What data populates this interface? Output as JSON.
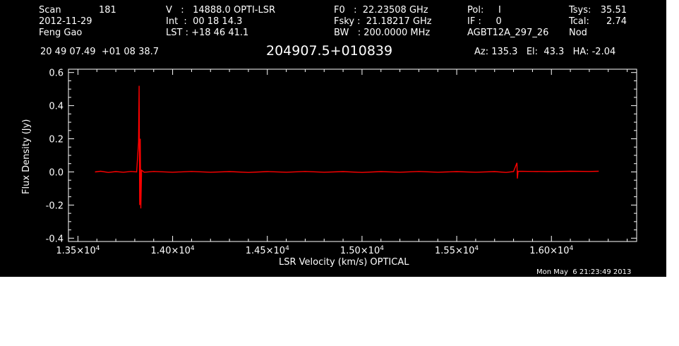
{
  "header": {
    "col1": {
      "scan_label": "Scan",
      "scan_value": "181",
      "date": "2012-11-29",
      "observer": "Feng Gao"
    },
    "col2": {
      "v_line": "V   :   14888.0 OPTI-LSR",
      "int_line": "Int  :  00 18 14.3",
      "lst_line": "LST : +18 46 41.1"
    },
    "col3": {
      "f0_line": "F0   :  22.23508 GHz",
      "fsky_line": "Fsky :  21.18217 GHz",
      "bw_line": "BW   : 200.0000 MHz"
    },
    "col4": {
      "pol_line": "Pol:     I",
      "if_line": "IF :     0",
      "project": "AGBT12A_297_26"
    },
    "col5": {
      "tsys_label": "Tsys:",
      "tsys_value": "35.51",
      "tcal_label": "Tcal:",
      "tcal_value": "2.74",
      "mode": "Nod"
    },
    "coords": "20 49 07.49  +01 08 38.7",
    "source": "204907.5+010839",
    "azel": "Az: 135.3   El:  43.3   HA: -2.04"
  },
  "footer": {
    "timestamp": "Mon May  6 21:23:49 2013"
  },
  "chart_data": {
    "type": "line",
    "xlabel": "LSR Velocity (km/s) OPTICAL",
    "ylabel": "Flux Density (Jy)",
    "xlim": [
      13450,
      16450
    ],
    "ylim": [
      -0.42,
      0.62
    ],
    "x_ticks": [
      13500,
      14000,
      14500,
      15000,
      15500,
      16000
    ],
    "x_tick_labels": [
      {
        "mant": "1.35×10",
        "exp": "4"
      },
      {
        "mant": "1.40×10",
        "exp": "4"
      },
      {
        "mant": "1.45×10",
        "exp": "4"
      },
      {
        "mant": "1.50×10",
        "exp": "4"
      },
      {
        "mant": "1.55×10",
        "exp": "4"
      },
      {
        "mant": "1.60×10",
        "exp": "4"
      }
    ],
    "y_ticks": [
      -0.4,
      -0.2,
      0.0,
      0.2,
      0.4,
      0.6
    ],
    "y_tick_labels": [
      "-0.4",
      "-0.2",
      "0.0",
      "0.2",
      "0.4",
      "0.6"
    ],
    "series": [
      {
        "color": "#ff0000",
        "points": [
          [
            13590,
            0.0
          ],
          [
            13620,
            0.004
          ],
          [
            13660,
            -0.003
          ],
          [
            13700,
            0.002
          ],
          [
            13740,
            -0.002
          ],
          [
            13780,
            0.003
          ],
          [
            13810,
            0.0
          ],
          [
            13820,
            0.18
          ],
          [
            13823,
            0.52
          ],
          [
            13826,
            -0.2
          ],
          [
            13829,
            0.2
          ],
          [
            13832,
            -0.22
          ],
          [
            13836,
            0.01
          ],
          [
            13850,
            -0.002
          ],
          [
            13900,
            0.003
          ],
          [
            14000,
            -0.002
          ],
          [
            14100,
            0.003
          ],
          [
            14200,
            -0.002
          ],
          [
            14300,
            0.002
          ],
          [
            14400,
            -0.003
          ],
          [
            14500,
            0.002
          ],
          [
            14600,
            -0.002
          ],
          [
            14700,
            0.003
          ],
          [
            14800,
            -0.002
          ],
          [
            14900,
            0.002
          ],
          [
            15000,
            -0.003
          ],
          [
            15100,
            0.002
          ],
          [
            15200,
            -0.002
          ],
          [
            15300,
            0.003
          ],
          [
            15400,
            -0.002
          ],
          [
            15500,
            0.002
          ],
          [
            15600,
            -0.002
          ],
          [
            15700,
            0.002
          ],
          [
            15760,
            -0.003
          ],
          [
            15800,
            0.002
          ],
          [
            15818,
            0.055
          ],
          [
            15820,
            -0.04
          ],
          [
            15824,
            0.004
          ],
          [
            15900,
            0.003
          ],
          [
            16000,
            0.002
          ],
          [
            16100,
            0.004
          ],
          [
            16200,
            0.003
          ],
          [
            16250,
            0.004
          ]
        ]
      }
    ]
  }
}
